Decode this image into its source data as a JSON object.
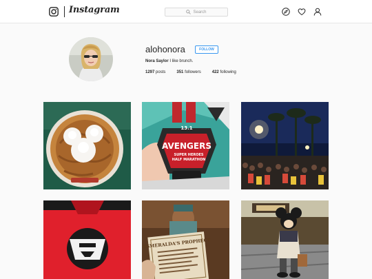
{
  "header": {
    "logo_text": "Instagram",
    "search_placeholder": "Search",
    "icons": [
      "instagram-camera-icon",
      "search-icon",
      "explore-compass-icon",
      "heart-icon",
      "profile-icon"
    ]
  },
  "profile": {
    "username": "alohonora",
    "follow_label": "FOLLOW",
    "full_name": "Nora Saylor",
    "bio": "I like brunch.",
    "stats": [
      {
        "count": "1297",
        "label": "posts"
      },
      {
        "count": "351",
        "label": "followers"
      },
      {
        "count": "422",
        "label": "following"
      }
    ]
  },
  "posts": {
    "p2": {
      "medal_top": "13.1",
      "medal_title": "AVENGERS",
      "medal_sub1": "SUPER HEROES",
      "medal_sub2": "HALF MARATHON"
    },
    "p5": {
      "sign_title": "ESMERALDA'S PROPHECY"
    }
  },
  "colors": {
    "accent": "#3897f0",
    "border": "#e6e6e6",
    "background": "#fafafa"
  }
}
